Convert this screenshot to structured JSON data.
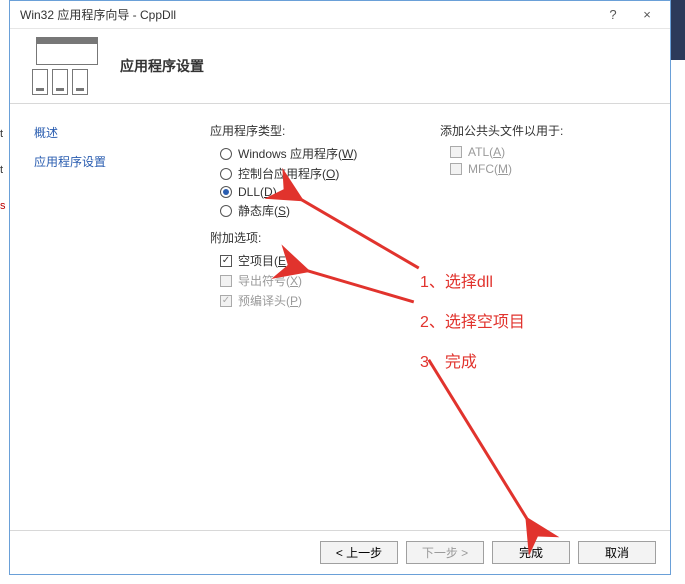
{
  "titlebar": {
    "title": "Win32 应用程序向导 - CppDll",
    "help": "?",
    "close": "×"
  },
  "header": {
    "title": "应用程序设置"
  },
  "sidebar": {
    "items": [
      {
        "label": "概述"
      },
      {
        "label": "应用程序设置"
      }
    ]
  },
  "content": {
    "app_type_label": "应用程序类型:",
    "app_type": [
      {
        "label": "Windows 应用程序(",
        "hot": "W",
        "tail": ")",
        "selected": false
      },
      {
        "label": "控制台应用程序(",
        "hot": "O",
        "tail": ")",
        "selected": false
      },
      {
        "label": "DLL(",
        "hot": "D",
        "tail": ")",
        "selected": true
      },
      {
        "label": "静态库(",
        "hot": "S",
        "tail": ")",
        "selected": false
      }
    ],
    "extra_label": "附加选项:",
    "extras": [
      {
        "label": "空项目(",
        "hot": "E",
        "tail": ")",
        "checked": true,
        "disabled": false
      },
      {
        "label": "导出符号(",
        "hot": "X",
        "tail": ")",
        "checked": false,
        "disabled": true
      },
      {
        "label": "预编译头(",
        "hot": "P",
        "tail": ")",
        "checked": true,
        "disabled": true
      }
    ],
    "headers_label": "添加公共头文件以用于:",
    "headers": [
      {
        "label": "ATL(",
        "hot": "A",
        "tail": ")",
        "checked": false,
        "disabled": true
      },
      {
        "label": "MFC(",
        "hot": "M",
        "tail": ")",
        "checked": false,
        "disabled": true
      }
    ]
  },
  "footer": {
    "prev": "< 上一步",
    "next": "下一步 >",
    "finish": "完成",
    "cancel": "取消"
  },
  "annotations": {
    "a1": "1、选择dll",
    "a2": "2、选择空项目",
    "a3": "3、完成"
  }
}
